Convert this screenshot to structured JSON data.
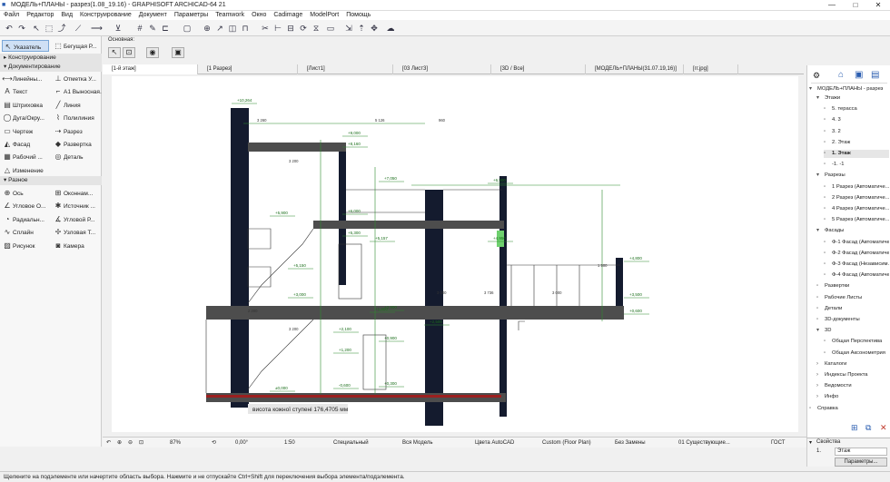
{
  "window": {
    "title": "МОДЕЛЬ+ПЛАНЫ - разрез(1.08_19.16) - GRAPHISOFT ARCHICAD-64 21",
    "minimize": "—",
    "maximize": "□",
    "close": "✕"
  },
  "menu": [
    "Файл",
    "Редактор",
    "Вид",
    "Конструирование",
    "Документ",
    "Параметры",
    "Teamwork",
    "Окно",
    "Cadimage",
    "ModelPort",
    "Помощь"
  ],
  "infobox": {
    "label": "Основная:"
  },
  "toolbox": {
    "pointer": "Указатель",
    "marquee": "Бегущая Р...",
    "sections": {
      "construct": "Конструирование",
      "document": "Документирование",
      "more": "Разное"
    },
    "doc_tools": [
      {
        "icon": "dimension-icon",
        "label": "Линейны..."
      },
      {
        "icon": "level-icon",
        "label": "Отметка У..."
      },
      {
        "icon": "text-icon",
        "label": "Текст"
      },
      {
        "icon": "label-icon",
        "label": "A1 Выносная..."
      },
      {
        "icon": "fill-icon",
        "label": "Штриховка"
      },
      {
        "icon": "line-icon",
        "label": "Линия"
      },
      {
        "icon": "arc-icon",
        "label": "Дуга/Окру..."
      },
      {
        "icon": "polyline-icon",
        "label": "Полилиния"
      },
      {
        "icon": "drawing-icon",
        "label": "Чертеж"
      },
      {
        "icon": "section-icon",
        "label": "Разрез"
      },
      {
        "icon": "elevation-icon",
        "label": "Фасад"
      },
      {
        "icon": "interior-icon",
        "label": "Развертка"
      },
      {
        "icon": "worksheet-icon",
        "label": "Рабочий ..."
      },
      {
        "icon": "detail-icon",
        "label": "Деталь"
      },
      {
        "icon": "change-icon",
        "label": "Изменение"
      }
    ],
    "more_tools": [
      {
        "icon": "grid-icon",
        "label": "Ось"
      },
      {
        "icon": "opening-icon",
        "label": "Оконнам..."
      },
      {
        "icon": "angle-icon",
        "label": "Угловое О..."
      },
      {
        "icon": "light-icon",
        "label": "Источник ..."
      },
      {
        "icon": "radial-icon",
        "label": "Радиальн..."
      },
      {
        "icon": "angle-r-icon",
        "label": "Угловой Р..."
      },
      {
        "icon": "spline-icon",
        "label": "Сплайн"
      },
      {
        "icon": "hotspot-icon",
        "label": "Узловая Т..."
      },
      {
        "icon": "picture-icon",
        "label": "Рисунок"
      },
      {
        "icon": "camera-icon",
        "label": "Камера"
      }
    ]
  },
  "tabs": [
    "[1-й этаж]",
    "[1 Разрез]",
    "[Лист1]",
    "[03 Лист3]",
    "[3D / Все]",
    "[МОДЕЛЬ+ПЛАНЫ(31.07.19,16)]",
    "[гг.jpg]"
  ],
  "drawing": {
    "levels": [
      "+10,264",
      "+9,000",
      "+8,160",
      "+7,050",
      "+6,500",
      "+6,000",
      "+5,900",
      "+5,300",
      "+5,157",
      "+5,150",
      "+4,950",
      "+4,800",
      "+3,900",
      "+3,500",
      "+3,000",
      "+2,500",
      "+2,100",
      "+1,800",
      "+1,200",
      "+0,900",
      "+0,600",
      "+0,300",
      "±0,000",
      "-0,600"
    ],
    "dims": [
      "3 260",
      "5 126",
      "960",
      "3 200",
      "3 200",
      "3 736",
      "3 000",
      "3 000",
      "2 200",
      "1 500"
    ],
    "caption": "висота кожної ступені 176,4705 мм"
  },
  "navigator": {
    "root": "МОДЕЛЬ+ПЛАНЫ - разрез",
    "items": [
      {
        "label": "Этажи",
        "indent": 1,
        "fold": "open"
      },
      {
        "label": "5. терасса",
        "indent": 2
      },
      {
        "label": "4. 3",
        "indent": 2
      },
      {
        "label": "3. 2",
        "indent": 2
      },
      {
        "label": "2. Этаж",
        "indent": 2
      },
      {
        "label": "1. Этаж",
        "indent": 2,
        "selected": true
      },
      {
        "label": "-1. -1",
        "indent": 2
      },
      {
        "label": "Разрезы",
        "indent": 1,
        "fold": "open"
      },
      {
        "label": "1 Разрез (Автоматиче...",
        "indent": 2
      },
      {
        "label": "2 Разрез (Автоматиче...",
        "indent": 2
      },
      {
        "label": "4 Разрез (Автоматиче...",
        "indent": 2
      },
      {
        "label": "5 Разрез (Автоматиче...",
        "indent": 2
      },
      {
        "label": "Фасады",
        "indent": 1,
        "fold": "open"
      },
      {
        "label": "Ф-1 Фасад (Автоматиче...",
        "indent": 2
      },
      {
        "label": "Ф-2 Фасад (Автоматиче...",
        "indent": 2
      },
      {
        "label": "Ф-3 Фасад (Независим...",
        "indent": 2
      },
      {
        "label": "Ф-4 Фасад (Автоматиче...",
        "indent": 2
      },
      {
        "label": "Развертки",
        "indent": 1
      },
      {
        "label": "Рабочие Листы",
        "indent": 1
      },
      {
        "label": "Детали",
        "indent": 1
      },
      {
        "label": "3D-документы",
        "indent": 1
      },
      {
        "label": "3D",
        "indent": 1,
        "fold": "open"
      },
      {
        "label": "Общая Перспектива",
        "indent": 2
      },
      {
        "label": "Общая Аксонометрия",
        "indent": 2
      },
      {
        "label": "Каталоги",
        "indent": 1,
        "fold": "closed"
      },
      {
        "label": "Индексы Проекта",
        "indent": 1,
        "fold": "closed"
      },
      {
        "label": "Ведомости",
        "indent": 1,
        "fold": "closed"
      },
      {
        "label": "Инфо",
        "indent": 1,
        "fold": "closed"
      },
      {
        "label": "Справка",
        "indent": 0
      }
    ]
  },
  "properties": {
    "title": "Свойства",
    "story_num": "1.",
    "story_name": "Этаж",
    "button": "Параметры..."
  },
  "status": {
    "zoom": "87%",
    "angle": "0,00°",
    "scale": "1:50",
    "layer": "Специальный",
    "model": "Вся Модель",
    "pen": "Цвета AutoCAD",
    "mvo": "Custom (Floor Plan)",
    "renov": "Без Замены",
    "renov2": "01 Существующие...",
    "standard": "ГОСТ"
  },
  "hint": "Щелкните на подэлементе или начертите область выбора. Нажмите и не отпускайте Ctrl+Shift для переключения выбора элемента/подэлемента."
}
